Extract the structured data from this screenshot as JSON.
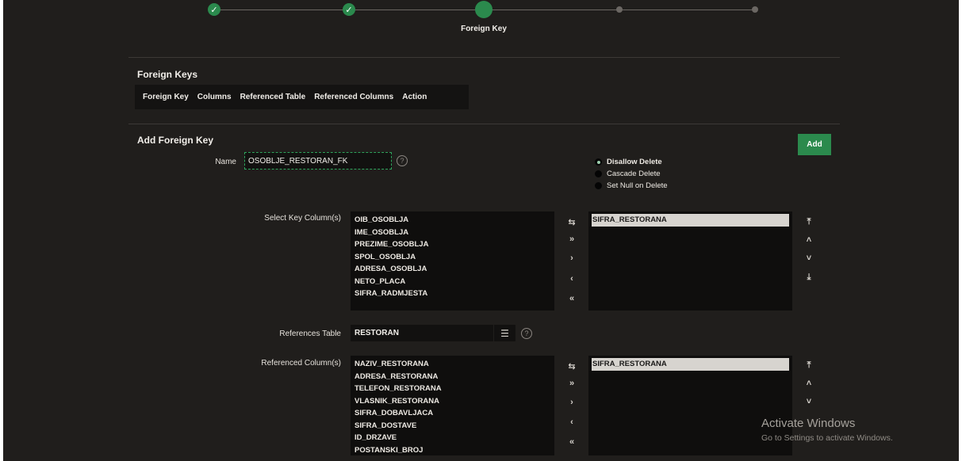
{
  "wizard": {
    "steps": [
      {
        "state": "done"
      },
      {
        "state": "done"
      },
      {
        "state": "current",
        "label": "Foreign Key"
      },
      {
        "state": "todo"
      },
      {
        "state": "todo"
      }
    ],
    "check_glyph": "✓"
  },
  "foreign_keys": {
    "title": "Foreign Keys",
    "columns": [
      "Foreign Key",
      "Columns",
      "Referenced Table",
      "Referenced Columns",
      "Action"
    ]
  },
  "add_fk": {
    "title": "Add Foreign Key",
    "add_label": "Add",
    "name_label": "Name",
    "name_value": "OSOBLJE_RESTORAN_FK",
    "help_glyph": "?",
    "delete_options": [
      "Disallow Delete",
      "Cascade Delete",
      "Set Null on Delete"
    ],
    "delete_selected": "Disallow Delete",
    "select_key_label": "Select Key Column(s)",
    "key_available": [
      "OIB_OSOBLJA",
      "IME_OSOBLJA",
      "PREZIME_OSOBLJA",
      "SPOL_OSOBLJA",
      "ADRESA_OSOBLJA",
      "NETO_PLACA",
      "SIFRA_RADMJESTA"
    ],
    "key_selected": [
      "SIFRA_RESTORANA"
    ],
    "references_table_label": "References Table",
    "references_table_value": "RESTORAN",
    "ref_cols_label": "Referenced Column(s)",
    "ref_available": [
      "NAZIV_RESTORANA",
      "ADRESA_RESTORANA",
      "TELEFON_RESTORANA",
      "VLASNIK_RESTORANA",
      "SIFRA_DOBAVLJACA",
      "SIFRA_DOSTAVE",
      "ID_DRZAVE",
      "POSTANSKI_BROJ"
    ],
    "ref_selected": [
      "SIFRA_RESTORANA"
    ]
  },
  "shuttle_glyphs": {
    "reset": "⇆",
    "move_all": "»",
    "move": "›",
    "remove": "‹",
    "remove_all": "«"
  },
  "order_glyphs": {
    "top": "⤒",
    "up": "˄",
    "down": "˅",
    "bottom": "⤓"
  },
  "lov_glyph": "☰",
  "watermark": {
    "line1": "Activate Windows",
    "line2": "Go to Settings to activate Windows."
  }
}
